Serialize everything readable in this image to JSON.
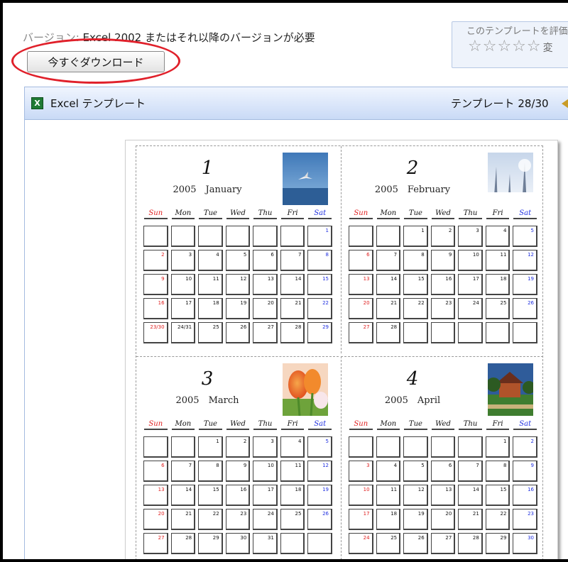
{
  "header": {
    "version_label": "バージョン:",
    "version_text": "Excel 2002 またはそれ以降のバージョンが必要",
    "download_button": "今すぐダウンロード",
    "rating_text": "このテンプレートを評価",
    "stars": "☆☆☆☆☆",
    "stars_more": "変"
  },
  "panel": {
    "icon_letter": "X",
    "title": "Excel テンプレート",
    "counter": "テンプレート 28/30"
  },
  "calendar": {
    "weekdays": [
      "Sun",
      "Mon",
      "Tue",
      "Wed",
      "Thu",
      "Fri",
      "Sat"
    ],
    "months": [
      {
        "number": "1",
        "year_month": "2005　January",
        "photo": "bird-in-sky-photo",
        "cells": [
          "",
          "",
          "",
          "",
          "",
          "",
          "1",
          "2",
          "3",
          "4",
          "5",
          "6",
          "7",
          "8",
          "9",
          "10",
          "11",
          "12",
          "13",
          "14",
          "15",
          "16",
          "17",
          "18",
          "19",
          "20",
          "21",
          "22",
          "23/30",
          "24/31",
          "25",
          "26",
          "27",
          "28",
          "29"
        ]
      },
      {
        "number": "2",
        "year_month": "2005　February",
        "photo": "snowy-forest-photo",
        "cells": [
          "",
          "",
          "1",
          "2",
          "3",
          "4",
          "5",
          "6",
          "7",
          "8",
          "9",
          "10",
          "11",
          "12",
          "13",
          "14",
          "15",
          "16",
          "17",
          "18",
          "19",
          "20",
          "21",
          "22",
          "23",
          "24",
          "25",
          "26",
          "27",
          "28",
          "",
          "",
          "",
          "",
          ""
        ]
      },
      {
        "number": "3",
        "year_month": "2005　March",
        "photo": "tulip-flower-photo",
        "cells": [
          "",
          "",
          "1",
          "2",
          "3",
          "4",
          "5",
          "6",
          "7",
          "8",
          "9",
          "10",
          "11",
          "12",
          "13",
          "14",
          "15",
          "16",
          "17",
          "18",
          "19",
          "20",
          "21",
          "22",
          "23",
          "24",
          "25",
          "26",
          "27",
          "28",
          "29",
          "30",
          "31",
          "",
          ""
        ]
      },
      {
        "number": "4",
        "year_month": "2005　April",
        "photo": "house-garden-photo",
        "cells": [
          "",
          "",
          "",
          "",
          "",
          "1",
          "2",
          "3",
          "4",
          "5",
          "6",
          "7",
          "8",
          "9",
          "10",
          "11",
          "12",
          "13",
          "14",
          "15",
          "16",
          "17",
          "18",
          "19",
          "20",
          "21",
          "22",
          "23",
          "24",
          "25",
          "26",
          "27",
          "28",
          "29",
          "30"
        ]
      }
    ]
  },
  "colors": {
    "sunday": "#e02020",
    "saturday": "#2030e0",
    "highlight_circle": "#e0202a",
    "panel_border": "#a4bbe0"
  }
}
